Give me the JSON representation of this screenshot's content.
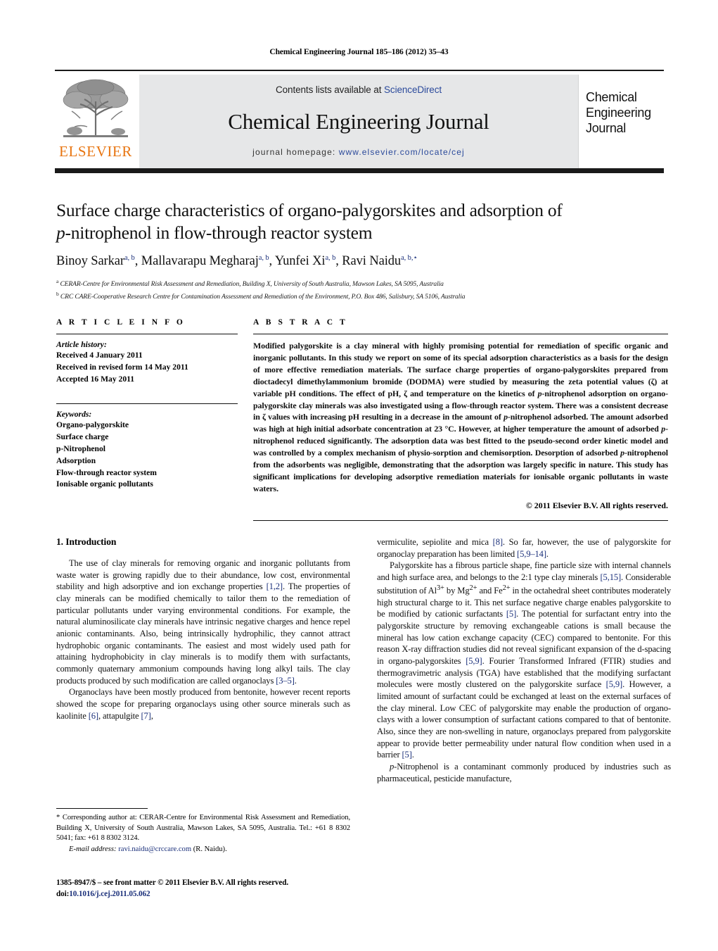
{
  "running_head": "Chemical Engineering Journal 185–186 (2012) 35–43",
  "masthead": {
    "contents_prefix": "Contents lists available at ",
    "sciencedirect": "ScienceDirect",
    "journal_name": "Chemical Engineering Journal",
    "homepage_prefix": "journal homepage: ",
    "homepage_url": "www.elsevier.com/locate/cej",
    "publisher_wordmark": "ELSEVIER",
    "cover_title_line1": "Chemical",
    "cover_title_line2": "Engineering",
    "cover_title_line3": "Journal",
    "accent_orange": "#e87511",
    "link_blue": "#2b4a9b",
    "band_gray": "#e6e7e8"
  },
  "title": {
    "line1": "Surface charge characteristics of organo-palygorskites and adsorption of",
    "line2_italic": "p",
    "line2_rest": "-nitrophenol in flow-through reactor system"
  },
  "authors": [
    {
      "name": "Binoy Sarkar",
      "sup": "a, b",
      "sep": ", "
    },
    {
      "name": "Mallavarapu Megharaj",
      "sup": "a, b",
      "sep": ", "
    },
    {
      "name": "Yunfei Xi",
      "sup": "a, b",
      "sep": ", "
    },
    {
      "name": "Ravi Naidu",
      "sup": "a, b,",
      "sep": ""
    }
  ],
  "affiliations": [
    {
      "marker": "a",
      "text": "CERAR-Centre for Environmental Risk Assessment and Remediation, Building X, University of South Australia, Mawson Lakes, SA 5095, Australia"
    },
    {
      "marker": "b",
      "text": "CRC CARE-Cooperative Research Centre for Contamination Assessment and Remediation of the Environment, P.O. Box 486, Salisbury, SA 5106, Australia"
    }
  ],
  "article_info": {
    "heading": "A R T I C L E   I N F O",
    "history_label": "Article history:",
    "history": [
      "Received 4 January 2011",
      "Received in revised form 14 May 2011",
      "Accepted 16 May 2011"
    ],
    "keywords_label": "Keywords:",
    "keywords": [
      "Organo-palygorskite",
      "Surface charge",
      "p-Nitrophenol",
      "Adsorption",
      "Flow-through reactor system",
      "Ionisable organic pollutants"
    ]
  },
  "abstract": {
    "heading": "A B S T R A C T",
    "text": "Modified palygorskite is a clay mineral with highly promising potential for remediation of specific organic and inorganic pollutants. In this study we report on some of its special adsorption characteristics as a basis for the design of more effective remediation materials. The surface charge properties of organo-palygorskites prepared from dioctadecyl dimethylammonium bromide (DODMA) were studied by measuring the zeta potential values (ζ) at variable pH conditions. The effect of pH, ζ and temperature on the kinetics of p-nitrophenol adsorption on organo-palygorskite clay minerals was also investigated using a flow-through reactor system. There was a consistent decrease in ζ values with increasing pH resulting in a decrease in the amount of p-nitrophenol adsorbed. The amount adsorbed was high at high initial adsorbate concentration at 23 °C. However, at higher temperature the amount of adsorbed p-nitrophenol reduced significantly. The adsorption data was best fitted to the pseudo-second order kinetic model and was controlled by a complex mechanism of physio-sorption and chemisorption. Desorption of adsorbed p-nitrophenol from the adsorbents was negligible, demonstrating that the adsorption was largely specific in nature. This study has significant implications for developing adsorptive remediation materials for ionisable organic pollutants in waste waters.",
    "copyright": "© 2011 Elsevier B.V. All rights reserved."
  },
  "section_heading": "1.  Introduction",
  "body": {
    "left_paragraphs": [
      "The use of clay minerals for removing organic and inorganic pollutants from waste water is growing rapidly due to their abundance, low cost, environmental stability and high adsorptive and ion exchange properties [1,2]. The properties of clay minerals can be modified chemically to tailor them to the remediation of particular pollutants under varying environmental conditions. For example, the natural aluminosilicate clay minerals have intrinsic negative charges and hence repel anionic contaminants. Also, being intrinsically hydrophilic, they cannot attract hydrophobic organic contaminants. The easiest and most widely used path for attaining hydrophobicity in clay minerals is to modify them with surfactants, commonly quaternary ammonium compounds having long alkyl tails. The clay products produced by such modification are called organoclays [3–5].",
      "Organoclays have been mostly produced from bentonite, however recent reports showed the scope for preparing organoclays using other source minerals such as kaolinite [6], attapulgite [7],"
    ],
    "right_paragraphs": [
      "vermiculite, sepiolite and mica [8]. So far, however, the use of palygorskite for organoclay preparation has been limited [5,9–14].",
      "Palygorskite has a fibrous particle shape, fine particle size with internal channels and high surface area, and belongs to the 2:1 type clay minerals [5,15]. Considerable substitution of Al3+ by Mg2+ and Fe2+ in the octahedral sheet contributes moderately high structural charge to it. This net surface negative charge enables palygorskite to be modified by cationic surfactants [5]. The potential for surfactant entry into the palygorskite structure by removing exchangeable cations is small because the mineral has low cation exchange capacity (CEC) compared to bentonite. For this reason X-ray diffraction studies did not reveal significant expansion of the d-spacing in organo-palygorskites [5,9]. Fourier Transformed Infrared (FTIR) studies and thermogravimetric analysis (TGA) have established that the modifying surfactant molecules were mostly clustered on the palygorskite surface [5,9]. However, a limited amount of surfactant could be exchanged at least on the external surfaces of the clay mineral. Low CEC of palygorskite may enable the production of organo-clays with a lower consumption of surfactant cations compared to that of bentonite. Also, since they are non-swelling in nature, organoclays prepared from palygorskite appear to provide better permeability under natural flow condition when used in a barrier [5].",
      "p-Nitrophenol is a contaminant commonly produced by industries such as pharmaceutical, pesticide manufacture,"
    ]
  },
  "footnote": {
    "text": "* Corresponding author at: CERAR-Centre for Environmental Risk Assessment and Remediation, Building X, University of South Australia, Mawson Lakes, SA 5095, Australia. Tel.: +61 8 8302 5041; fax: +61 8 8302 3124.",
    "email_label": "E-mail address:",
    "email": "ravi.naidu@crccare.com",
    "email_owner": "(R. Naidu)."
  },
  "imprint": {
    "line1": "1385-8947/$ – see front matter © 2011 Elsevier B.V. All rights reserved.",
    "doi_prefix": "doi:",
    "doi": "10.1016/j.cej.2011.05.062"
  }
}
